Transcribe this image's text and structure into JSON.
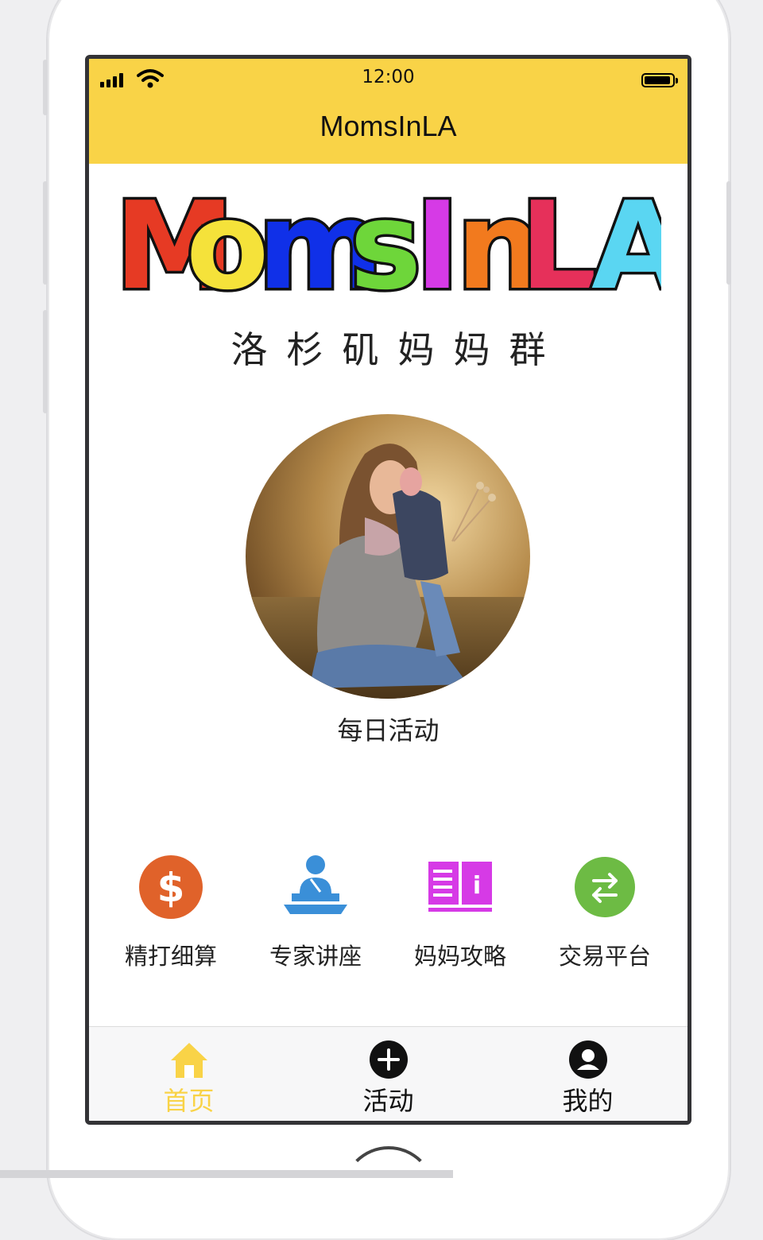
{
  "status_bar": {
    "time": "12:00",
    "signal_bars": 4,
    "battery_level": 0.95
  },
  "nav_bar": {
    "title": "MomsInLA"
  },
  "logo": {
    "letters": [
      {
        "char": "M",
        "color": "#e63a24"
      },
      {
        "char": "o",
        "color": "#f5e23a"
      },
      {
        "char": "m",
        "color": "#1030e8"
      },
      {
        "char": "s",
        "color": "#6ed63a"
      },
      {
        "char": "I",
        "color": "#d63ae6"
      },
      {
        "char": "n",
        "color": "#f27a1e"
      },
      {
        "char": "L",
        "color": "#e6305a"
      },
      {
        "char": "A",
        "color": "#5ad6f2"
      }
    ],
    "subtitle": "洛杉矶妈妈群"
  },
  "featured": {
    "caption": "每日活动"
  },
  "features": [
    {
      "label": "精打细算",
      "icon": "dollar-icon",
      "color": "#e0622a"
    },
    {
      "label": "专家讲座",
      "icon": "lecture-icon",
      "color": "#3a8fd8"
    },
    {
      "label": "妈妈攻略",
      "icon": "guide-book-icon",
      "color": "#d63ae6"
    },
    {
      "label": "交易平台",
      "icon": "exchange-icon",
      "color": "#6dbb44"
    }
  ],
  "tabs": [
    {
      "label": "首页",
      "icon": "home-icon",
      "active": true
    },
    {
      "label": "活动",
      "icon": "add-circle-icon",
      "active": false
    },
    {
      "label": "我的",
      "icon": "user-icon",
      "active": false
    }
  ],
  "colors": {
    "accent": "#f9d347"
  }
}
